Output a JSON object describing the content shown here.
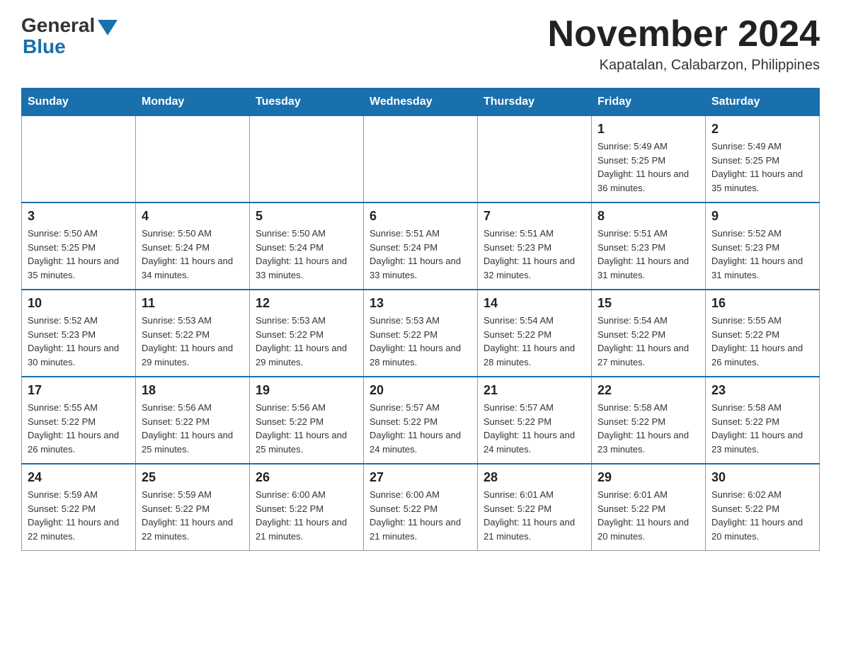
{
  "logo": {
    "general": "General",
    "blue": "Blue"
  },
  "title": "November 2024",
  "location": "Kapatalan, Calabarzon, Philippines",
  "days_of_week": [
    "Sunday",
    "Monday",
    "Tuesday",
    "Wednesday",
    "Thursday",
    "Friday",
    "Saturday"
  ],
  "weeks": [
    [
      {
        "day": "",
        "info": ""
      },
      {
        "day": "",
        "info": ""
      },
      {
        "day": "",
        "info": ""
      },
      {
        "day": "",
        "info": ""
      },
      {
        "day": "",
        "info": ""
      },
      {
        "day": "1",
        "info": "Sunrise: 5:49 AM\nSunset: 5:25 PM\nDaylight: 11 hours and 36 minutes."
      },
      {
        "day": "2",
        "info": "Sunrise: 5:49 AM\nSunset: 5:25 PM\nDaylight: 11 hours and 35 minutes."
      }
    ],
    [
      {
        "day": "3",
        "info": "Sunrise: 5:50 AM\nSunset: 5:25 PM\nDaylight: 11 hours and 35 minutes."
      },
      {
        "day": "4",
        "info": "Sunrise: 5:50 AM\nSunset: 5:24 PM\nDaylight: 11 hours and 34 minutes."
      },
      {
        "day": "5",
        "info": "Sunrise: 5:50 AM\nSunset: 5:24 PM\nDaylight: 11 hours and 33 minutes."
      },
      {
        "day": "6",
        "info": "Sunrise: 5:51 AM\nSunset: 5:24 PM\nDaylight: 11 hours and 33 minutes."
      },
      {
        "day": "7",
        "info": "Sunrise: 5:51 AM\nSunset: 5:23 PM\nDaylight: 11 hours and 32 minutes."
      },
      {
        "day": "8",
        "info": "Sunrise: 5:51 AM\nSunset: 5:23 PM\nDaylight: 11 hours and 31 minutes."
      },
      {
        "day": "9",
        "info": "Sunrise: 5:52 AM\nSunset: 5:23 PM\nDaylight: 11 hours and 31 minutes."
      }
    ],
    [
      {
        "day": "10",
        "info": "Sunrise: 5:52 AM\nSunset: 5:23 PM\nDaylight: 11 hours and 30 minutes."
      },
      {
        "day": "11",
        "info": "Sunrise: 5:53 AM\nSunset: 5:22 PM\nDaylight: 11 hours and 29 minutes."
      },
      {
        "day": "12",
        "info": "Sunrise: 5:53 AM\nSunset: 5:22 PM\nDaylight: 11 hours and 29 minutes."
      },
      {
        "day": "13",
        "info": "Sunrise: 5:53 AM\nSunset: 5:22 PM\nDaylight: 11 hours and 28 minutes."
      },
      {
        "day": "14",
        "info": "Sunrise: 5:54 AM\nSunset: 5:22 PM\nDaylight: 11 hours and 28 minutes."
      },
      {
        "day": "15",
        "info": "Sunrise: 5:54 AM\nSunset: 5:22 PM\nDaylight: 11 hours and 27 minutes."
      },
      {
        "day": "16",
        "info": "Sunrise: 5:55 AM\nSunset: 5:22 PM\nDaylight: 11 hours and 26 minutes."
      }
    ],
    [
      {
        "day": "17",
        "info": "Sunrise: 5:55 AM\nSunset: 5:22 PM\nDaylight: 11 hours and 26 minutes."
      },
      {
        "day": "18",
        "info": "Sunrise: 5:56 AM\nSunset: 5:22 PM\nDaylight: 11 hours and 25 minutes."
      },
      {
        "day": "19",
        "info": "Sunrise: 5:56 AM\nSunset: 5:22 PM\nDaylight: 11 hours and 25 minutes."
      },
      {
        "day": "20",
        "info": "Sunrise: 5:57 AM\nSunset: 5:22 PM\nDaylight: 11 hours and 24 minutes."
      },
      {
        "day": "21",
        "info": "Sunrise: 5:57 AM\nSunset: 5:22 PM\nDaylight: 11 hours and 24 minutes."
      },
      {
        "day": "22",
        "info": "Sunrise: 5:58 AM\nSunset: 5:22 PM\nDaylight: 11 hours and 23 minutes."
      },
      {
        "day": "23",
        "info": "Sunrise: 5:58 AM\nSunset: 5:22 PM\nDaylight: 11 hours and 23 minutes."
      }
    ],
    [
      {
        "day": "24",
        "info": "Sunrise: 5:59 AM\nSunset: 5:22 PM\nDaylight: 11 hours and 22 minutes."
      },
      {
        "day": "25",
        "info": "Sunrise: 5:59 AM\nSunset: 5:22 PM\nDaylight: 11 hours and 22 minutes."
      },
      {
        "day": "26",
        "info": "Sunrise: 6:00 AM\nSunset: 5:22 PM\nDaylight: 11 hours and 21 minutes."
      },
      {
        "day": "27",
        "info": "Sunrise: 6:00 AM\nSunset: 5:22 PM\nDaylight: 11 hours and 21 minutes."
      },
      {
        "day": "28",
        "info": "Sunrise: 6:01 AM\nSunset: 5:22 PM\nDaylight: 11 hours and 21 minutes."
      },
      {
        "day": "29",
        "info": "Sunrise: 6:01 AM\nSunset: 5:22 PM\nDaylight: 11 hours and 20 minutes."
      },
      {
        "day": "30",
        "info": "Sunrise: 6:02 AM\nSunset: 5:22 PM\nDaylight: 11 hours and 20 minutes."
      }
    ]
  ]
}
